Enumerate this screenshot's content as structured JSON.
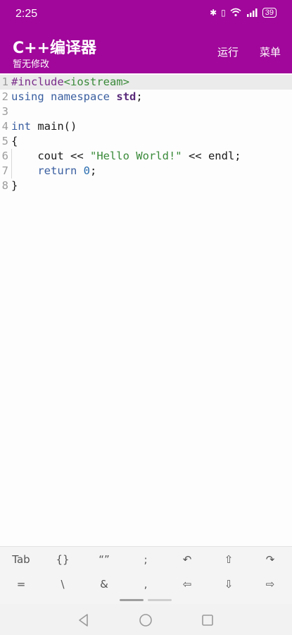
{
  "status": {
    "time": "2:25",
    "battery": "39"
  },
  "app": {
    "title": "C++编译器",
    "subtitle": "暂无修改",
    "run_label": "运行",
    "menu_label": "菜单"
  },
  "editor": {
    "line_numbers": [
      "1",
      "2",
      "3",
      "4",
      "5",
      "6",
      "7",
      "8"
    ],
    "line1": {
      "pp": "#include",
      "inc": "<iostream>"
    },
    "line2": {
      "kw1": "using",
      "kw2": "namespace",
      "ns": "std",
      "semi": ";"
    },
    "line4": {
      "kw": "int",
      "rest": " main()"
    },
    "line5": {
      "brace": "{"
    },
    "line6": {
      "a": "    cout << ",
      "str": "\"Hello World!\"",
      "b": " << endl;"
    },
    "line7": {
      "kw": "return",
      "num": "0",
      "semi": ";"
    },
    "line8": {
      "brace": "}"
    }
  },
  "symbols": {
    "row1": [
      "Tab",
      "{}",
      "“”",
      ";",
      "↶",
      "⇧",
      "↷"
    ],
    "row2": [
      "=",
      "\\",
      "&",
      ",",
      "⇦",
      "⇩",
      "⇨"
    ]
  },
  "colors": {
    "app_bar": "#a0079a",
    "keyword": "#3a5fa0",
    "string": "#3a8a3a"
  }
}
